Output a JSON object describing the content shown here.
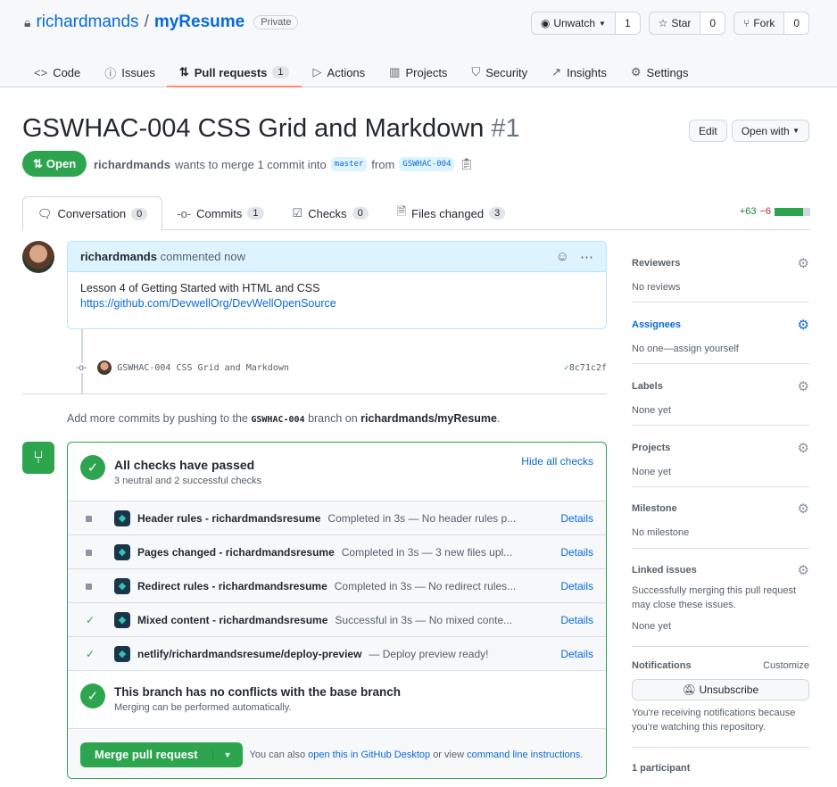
{
  "repo": {
    "owner": "richardmands",
    "name": "myResume",
    "visibility": "Private"
  },
  "actions": {
    "watch": "Unwatch",
    "watch_count": "1",
    "star": "Star",
    "star_count": "0",
    "fork": "Fork",
    "fork_count": "0"
  },
  "nav": [
    {
      "label": "Code"
    },
    {
      "label": "Issues"
    },
    {
      "label": "Pull requests",
      "count": "1"
    },
    {
      "label": "Actions"
    },
    {
      "label": "Projects"
    },
    {
      "label": "Security"
    },
    {
      "label": "Insights"
    },
    {
      "label": "Settings"
    }
  ],
  "pr": {
    "title": "GSWHAC-004 CSS Grid and Markdown",
    "number": "#1",
    "state": "Open",
    "author": "richardmands",
    "merge_text": "wants to merge 1 commit into",
    "base": "master",
    "from": "from",
    "head": "GSWHAC-004",
    "edit": "Edit",
    "open_with": "Open with"
  },
  "tabs": [
    {
      "label": "Conversation",
      "count": "0"
    },
    {
      "label": "Commits",
      "count": "1"
    },
    {
      "label": "Checks",
      "count": "0"
    },
    {
      "label": "Files changed",
      "count": "3"
    }
  ],
  "diffstat": {
    "additions": "+63",
    "deletions": "−6",
    "colors": {
      "add": "#2da44e",
      "del": "#cf222e"
    }
  },
  "comment": {
    "author": "richardmands",
    "action": "commented now",
    "body": "Lesson 4 of Getting Started with HTML and CSS",
    "link": "https://github.com/DevwellOrg/DevWellOpenSource"
  },
  "commit": {
    "message": "GSWHAC-004 CSS Grid and Markdown",
    "sha": "8c71c2f"
  },
  "push_hint": {
    "pre": "Add more commits by pushing to the",
    "branch": "GSWHAC-004",
    "mid": "branch on",
    "repo": "richardmands/myResume",
    "end": "."
  },
  "checks": {
    "title": "All checks have passed",
    "subtitle": "3 neutral and 2 successful checks",
    "hide": "Hide all checks",
    "details": "Details",
    "items": [
      {
        "status": "neutral",
        "name": "Header rules - richardmandsresume",
        "desc": "Completed in 3s — No header rules p..."
      },
      {
        "status": "neutral",
        "name": "Pages changed - richardmandsresume",
        "desc": "Completed in 3s — 3 new files upl..."
      },
      {
        "status": "neutral",
        "name": "Redirect rules - richardmandsresume",
        "desc": "Completed in 3s — No redirect rules..."
      },
      {
        "status": "success",
        "name": "Mixed content - richardmandsresume",
        "desc": "Successful in 3s — No mixed conte..."
      },
      {
        "status": "success",
        "name": "netlify/richardmandsresume/deploy-preview",
        "desc": "— Deploy preview ready!"
      }
    ]
  },
  "conflicts": {
    "title": "This branch has no conflicts with the base branch",
    "subtitle": "Merging can be performed automatically."
  },
  "merge": {
    "button": "Merge pull request",
    "also": "You can also",
    "desktop": "open this in GitHub Desktop",
    "or": "or view",
    "cli": "command line instructions",
    "end": "."
  },
  "sidebar": {
    "reviewers": {
      "title": "Reviewers",
      "value": "No reviews"
    },
    "assignees": {
      "title": "Assignees",
      "value": "No one—assign yourself"
    },
    "labels": {
      "title": "Labels",
      "value": "None yet"
    },
    "projects": {
      "title": "Projects",
      "value": "None yet"
    },
    "milestone": {
      "title": "Milestone",
      "value": "No milestone"
    },
    "linked": {
      "title": "Linked issues",
      "desc": "Successfully merging this pull request may close these issues.",
      "value": "None yet"
    },
    "notifications": {
      "title": "Notifications",
      "customize": "Customize",
      "button": "Unsubscribe",
      "desc": "You're receiving notifications because you're watching this repository."
    },
    "participants": "1 participant"
  }
}
